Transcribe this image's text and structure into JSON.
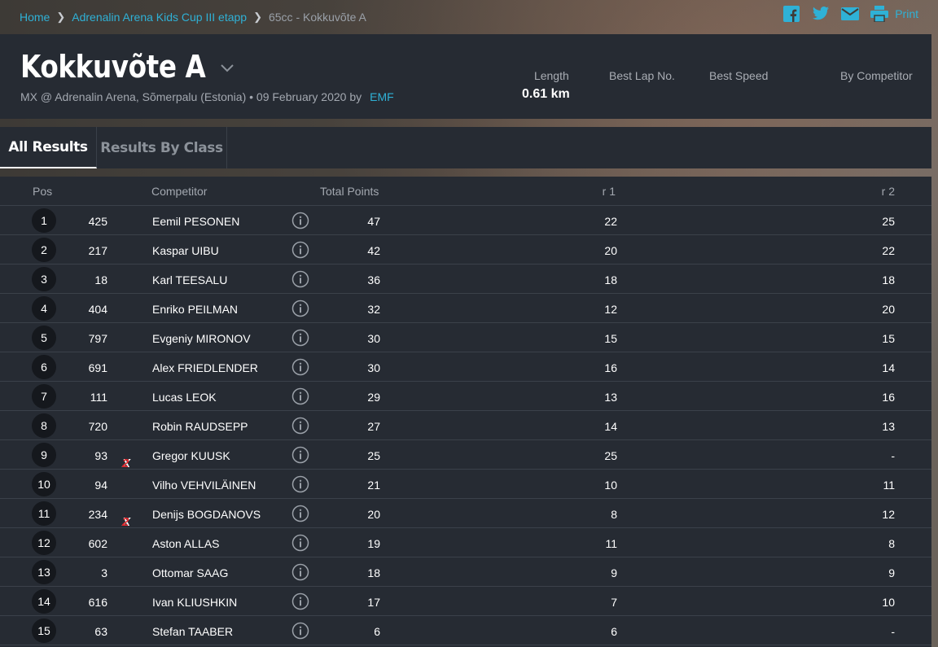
{
  "breadcrumb": [
    {
      "label": "Home",
      "link": true
    },
    {
      "label": "Adrenalin Arena Kids Cup III etapp",
      "link": true
    },
    {
      "label": "65cc - Kokkuvõte A",
      "link": false
    }
  ],
  "share": {
    "icons": [
      "facebook-icon",
      "twitter-icon",
      "email-icon",
      "print-icon"
    ],
    "print_label": "Print"
  },
  "header": {
    "title": "Kokkuvõte A",
    "subtitle": "MX @ Adrenalin Arena, Sõmerpalu (Estonia) • 09 February 2020 by",
    "organizer": "EMF",
    "stats": [
      {
        "label": "Length",
        "value": "0.61 km"
      },
      {
        "label": "Best Lap No.",
        "value": ""
      },
      {
        "label": "Best Speed",
        "value": ""
      },
      {
        "label": "By Competitor",
        "value": ""
      }
    ]
  },
  "tabs": [
    {
      "label": "All Results",
      "active": true
    },
    {
      "label": "Results By Class",
      "active": false
    }
  ],
  "table": {
    "columns": {
      "pos": "Pos",
      "competitor": "Competitor",
      "total": "Total Points",
      "r1": "r 1",
      "r2": "r 2"
    },
    "rows": [
      {
        "pos": "1",
        "num": "425",
        "x2": false,
        "name": "Eemil PESONEN",
        "total": "47",
        "r1": "22",
        "r2": "25"
      },
      {
        "pos": "2",
        "num": "217",
        "x2": false,
        "name": "Kaspar UIBU",
        "total": "42",
        "r1": "20",
        "r2": "22"
      },
      {
        "pos": "3",
        "num": "18",
        "x2": false,
        "name": "Karl TEESALU",
        "total": "36",
        "r1": "18",
        "r2": "18"
      },
      {
        "pos": "4",
        "num": "404",
        "x2": false,
        "name": "Enriko PEILMAN",
        "total": "32",
        "r1": "12",
        "r2": "20"
      },
      {
        "pos": "5",
        "num": "797",
        "x2": false,
        "name": "Evgeniy MIRONOV",
        "total": "30",
        "r1": "15",
        "r2": "15"
      },
      {
        "pos": "6",
        "num": "691",
        "x2": false,
        "name": "Alex FRIEDLENDER",
        "total": "30",
        "r1": "16",
        "r2": "14"
      },
      {
        "pos": "7",
        "num": "111",
        "x2": false,
        "name": "Lucas LEOK",
        "total": "29",
        "r1": "13",
        "r2": "16"
      },
      {
        "pos": "8",
        "num": "720",
        "x2": false,
        "name": "Robin RAUDSEPP",
        "total": "27",
        "r1": "14",
        "r2": "13"
      },
      {
        "pos": "9",
        "num": "93",
        "x2": true,
        "name": "Gregor KUUSK",
        "total": "25",
        "r1": "25",
        "r2": "-"
      },
      {
        "pos": "10",
        "num": "94",
        "x2": false,
        "name": "Vilho VEHVILÄINEN",
        "total": "21",
        "r1": "10",
        "r2": "11"
      },
      {
        "pos": "11",
        "num": "234",
        "x2": true,
        "name": "Denijs BOGDANOVS",
        "total": "20",
        "r1": "8",
        "r2": "12"
      },
      {
        "pos": "12",
        "num": "602",
        "x2": false,
        "name": "Aston ALLAS",
        "total": "19",
        "r1": "11",
        "r2": "8"
      },
      {
        "pos": "13",
        "num": "3",
        "x2": false,
        "name": "Ottomar SAAG",
        "total": "18",
        "r1": "9",
        "r2": "9"
      },
      {
        "pos": "14",
        "num": "616",
        "x2": false,
        "name": "Ivan KLIUSHKIN",
        "total": "17",
        "r1": "7",
        "r2": "10"
      },
      {
        "pos": "15",
        "num": "63",
        "x2": false,
        "name": "Stefan TAABER",
        "total": "6",
        "r1": "6",
        "r2": "-"
      }
    ],
    "x2_mark": {
      "x": "X",
      "two": "2"
    }
  },
  "colors": {
    "accent": "#2fb1d6",
    "panel": "#262b33",
    "badge": "#15181d",
    "x2_red": "#e0262b"
  }
}
